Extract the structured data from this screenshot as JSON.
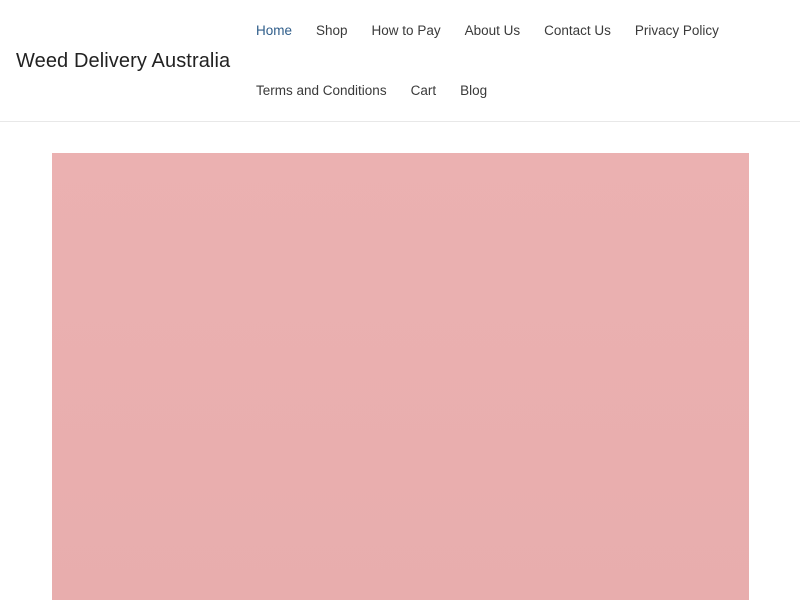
{
  "site": {
    "title": "Weed Delivery Australia"
  },
  "nav": {
    "row1": [
      {
        "label": "Home",
        "active": true
      },
      {
        "label": "Shop",
        "active": false
      },
      {
        "label": "How to Pay",
        "active": false
      },
      {
        "label": "About Us",
        "active": false
      },
      {
        "label": "Contact Us",
        "active": false
      },
      {
        "label": "Privacy Policy",
        "active": false
      }
    ],
    "row2": [
      {
        "label": "Terms and Conditions",
        "active": false
      },
      {
        "label": "Cart",
        "active": false
      },
      {
        "label": "Blog",
        "active": false
      }
    ]
  },
  "colors": {
    "accent": "#2f5d8a",
    "hero_placeholder": "#eaafaf"
  }
}
